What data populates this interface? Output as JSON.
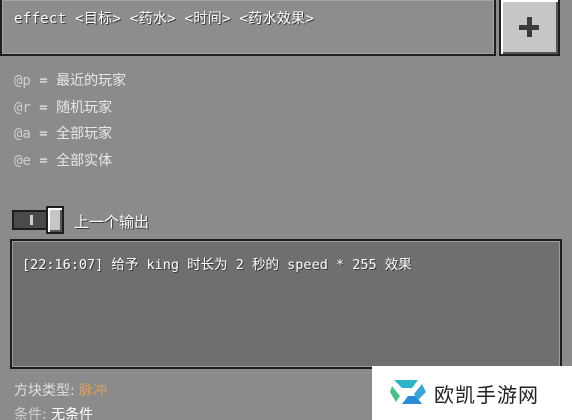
{
  "command_input": {
    "value": "effect <目标> <药水> <时间> <药水效果>"
  },
  "add_button": {
    "icon": "plus-icon"
  },
  "selectors": [
    {
      "code": "@p",
      "sep": " = ",
      "desc": "最近的玩家"
    },
    {
      "code": "@r",
      "sep": " = ",
      "desc": "随机玩家"
    },
    {
      "code": "@a",
      "sep": " = ",
      "desc": "全部玩家"
    },
    {
      "code": "@e",
      "sep": " = ",
      "desc": "全部实体"
    }
  ],
  "previous_output": {
    "toggle_label": "上一个输出",
    "line": "[22:16:07] 给予 king 时长为 2 秒的 speed * 255 效果"
  },
  "block_info": {
    "type_label": "方块类型: ",
    "type_value": "脉冲",
    "condition_label": "条件: ",
    "condition_value": "无条件"
  },
  "watermark": {
    "text": "欧凯手游网"
  },
  "colors": {
    "background": "#8b8b8b",
    "button": "#c6c6c6",
    "accent_value": "#d9a25e",
    "output_bg": "#6f6f6f"
  }
}
